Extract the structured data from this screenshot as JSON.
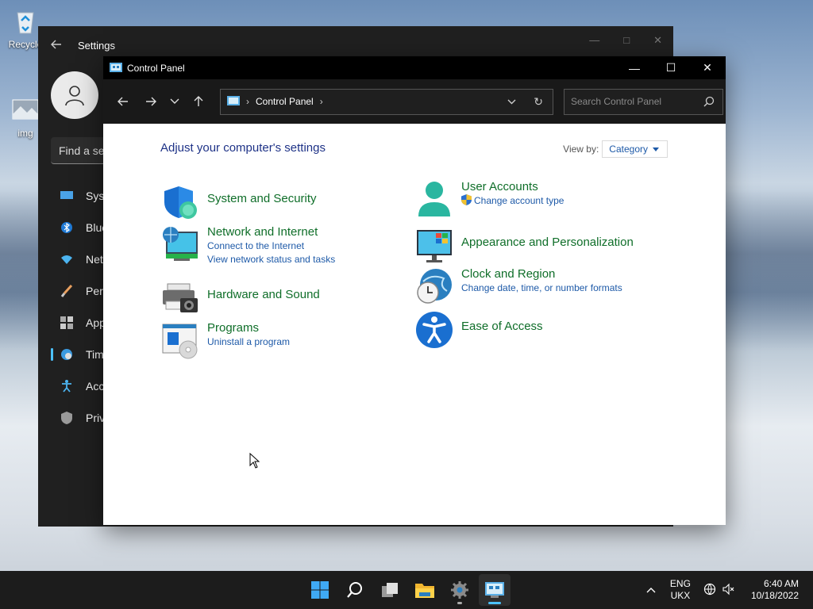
{
  "desktop": {
    "icons": [
      {
        "label": "Recycle"
      },
      {
        "label": "img"
      }
    ]
  },
  "settings_window": {
    "title": "Settings",
    "search_placeholder": "Find a se",
    "nav": [
      {
        "label": "Syst"
      },
      {
        "label": "Blue"
      },
      {
        "label": "Net"
      },
      {
        "label": "Pers"
      },
      {
        "label": "App"
      },
      {
        "label": "Tim"
      },
      {
        "label": "Acc"
      },
      {
        "label": "Priv"
      }
    ]
  },
  "control_panel": {
    "title": "Control Panel",
    "address": {
      "crumb": "Control Panel"
    },
    "search": {
      "placeholder": "Search Control Panel"
    },
    "heading": "Adjust your computer's settings",
    "view_by": {
      "label": "View by:",
      "value": "Category"
    },
    "categories": [
      {
        "title": "System and Security",
        "links": []
      },
      {
        "title": "Network and Internet",
        "links": [
          "Connect to the Internet",
          "View network status and tasks"
        ]
      },
      {
        "title": "Hardware and Sound",
        "links": []
      },
      {
        "title": "Programs",
        "links": [
          "Uninstall a program"
        ]
      },
      {
        "title": "User Accounts",
        "links": [
          "Change account type"
        ]
      },
      {
        "title": "Appearance and Personalization",
        "links": []
      },
      {
        "title": "Clock and Region",
        "links": [
          "Change date, time, or number formats"
        ]
      },
      {
        "title": "Ease of Access",
        "links": []
      }
    ]
  },
  "taskbar": {
    "language": {
      "line1": "ENG",
      "line2": "UKX"
    },
    "time": "6:40 AM",
    "date": "10/18/2022"
  }
}
